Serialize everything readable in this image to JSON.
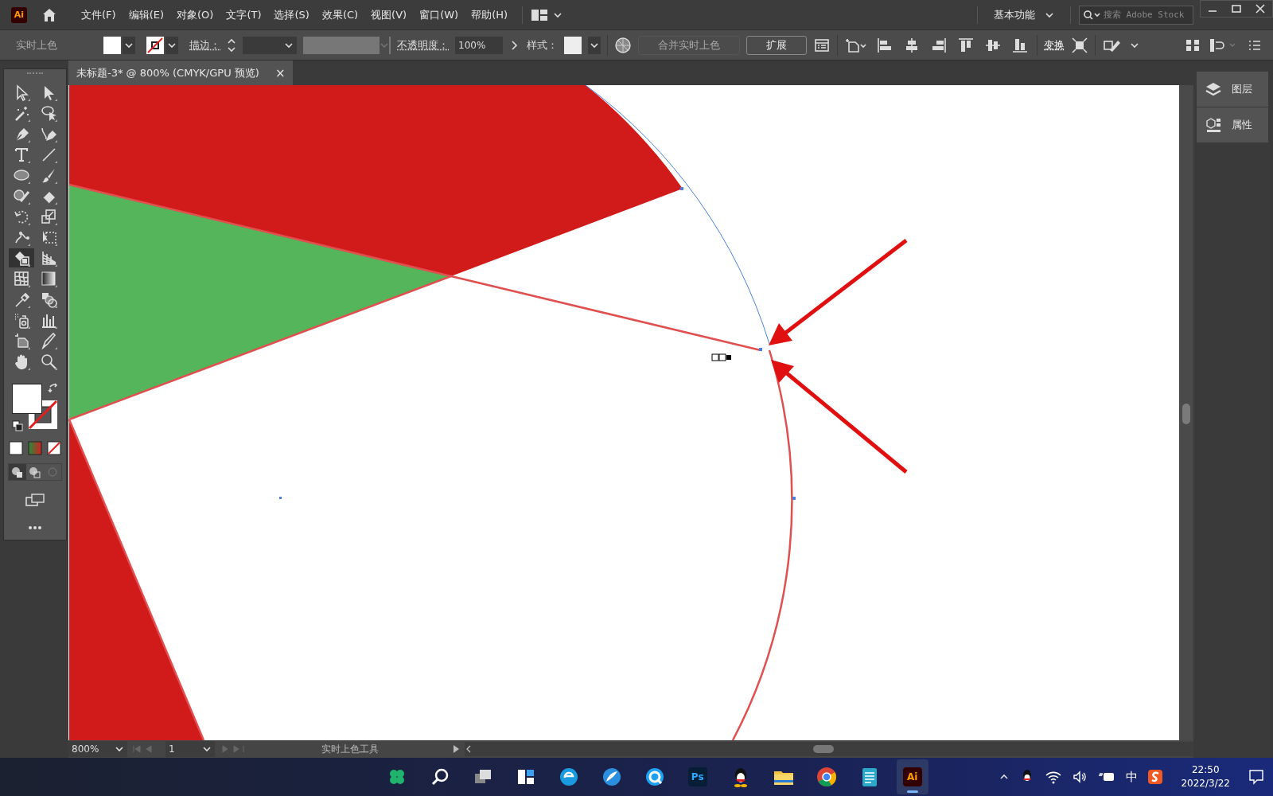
{
  "app": {
    "logo": "Ai"
  },
  "menu": [
    {
      "label": "文件(F)"
    },
    {
      "label": "编辑(E)"
    },
    {
      "label": "对象(O)"
    },
    {
      "label": "文字(T)"
    },
    {
      "label": "选择(S)"
    },
    {
      "label": "效果(C)"
    },
    {
      "label": "视图(V)"
    },
    {
      "label": "窗口(W)"
    },
    {
      "label": "帮助(H)"
    }
  ],
  "workspace": {
    "label": "基本功能"
  },
  "search": {
    "placeholder": "搜索 Adobe Stock"
  },
  "control_bar": {
    "tool_label": "实时上色",
    "stroke_label": "描边：",
    "opacity_label": "不透明度：",
    "opacity": "100%",
    "style_label": "样式：",
    "merge_button": {
      "label": "合并实时上色",
      "disabled": true
    },
    "expand_button": {
      "label": "扩展",
      "disabled": false
    },
    "transform_label": "变换"
  },
  "document_tab": {
    "title": "未标题-3* @ 800% (CMYK/GPU 预览)",
    "close": "×"
  },
  "tools": [
    {
      "kind": "select",
      "selected": false
    },
    {
      "kind": "direct",
      "selected": false
    },
    {
      "kind": "wand",
      "selected": false
    },
    {
      "kind": "lasso",
      "selected": false
    },
    {
      "kind": "pen",
      "selected": false
    },
    {
      "kind": "curvature",
      "selected": false
    },
    {
      "kind": "type",
      "selected": false
    },
    {
      "kind": "line",
      "selected": false
    },
    {
      "kind": "ellipse",
      "selected": false
    },
    {
      "kind": "brush",
      "selected": false
    },
    {
      "kind": "blob",
      "selected": false
    },
    {
      "kind": "eraser",
      "selected": false
    },
    {
      "kind": "rotate",
      "selected": false
    },
    {
      "kind": "scale",
      "selected": false
    },
    {
      "kind": "warp",
      "selected": false
    },
    {
      "kind": "freetransform",
      "selected": false
    },
    {
      "kind": "livepaint",
      "selected": true
    },
    {
      "kind": "perspective",
      "selected": false
    },
    {
      "kind": "mesh",
      "selected": false
    },
    {
      "kind": "gradient",
      "selected": false
    },
    {
      "kind": "eyedropper",
      "selected": false
    },
    {
      "kind": "blend",
      "selected": false
    },
    {
      "kind": "spray",
      "selected": false
    },
    {
      "kind": "graph",
      "selected": false
    },
    {
      "kind": "artboard",
      "selected": false
    },
    {
      "kind": "slice",
      "selected": false
    },
    {
      "kind": "hand",
      "selected": false
    },
    {
      "kind": "zoom",
      "selected": false
    }
  ],
  "panels": [
    {
      "label": "图层",
      "kind": "layers"
    },
    {
      "label": "属性",
      "kind": "properties"
    }
  ],
  "status_bar": {
    "zoom": "800%",
    "artboard": "1",
    "tool": "实时上色工具"
  },
  "taskbar": [
    {
      "kind": "widgets",
      "active": false
    },
    {
      "kind": "search",
      "active": false
    },
    {
      "kind": "taskview",
      "active": false
    },
    {
      "kind": "snap",
      "active": false
    },
    {
      "kind": "edge",
      "active": false
    },
    {
      "kind": "feather",
      "active": false
    },
    {
      "kind": "cloud",
      "active": false
    },
    {
      "kind": "ps",
      "label": "Ps",
      "active": false
    },
    {
      "kind": "qq",
      "active": false
    },
    {
      "kind": "folder",
      "active": false
    },
    {
      "kind": "chrome",
      "active": false
    },
    {
      "kind": "notepad",
      "active": false
    },
    {
      "kind": "ai",
      "label": "Ai",
      "active": true
    }
  ],
  "tray": {
    "ime": "中",
    "time": "22:50",
    "date": "2022/3/22"
  }
}
